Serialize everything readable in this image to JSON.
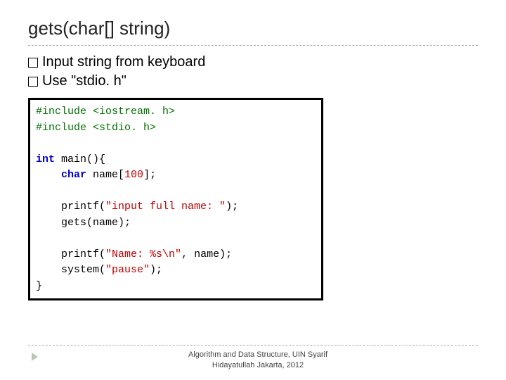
{
  "slide": {
    "title": "gets(char[] string)",
    "bullets": [
      "Input string from keyboard",
      "Use \"stdio. h\""
    ]
  },
  "code": {
    "tokens": [
      {
        "t": "pp",
        "v": "#include <iostream. h>"
      },
      {
        "t": "nl"
      },
      {
        "t": "pp",
        "v": "#include <stdio. h>"
      },
      {
        "t": "nl"
      },
      {
        "t": "nl"
      },
      {
        "t": "kw",
        "v": "int"
      },
      {
        "t": "pl",
        "v": " main(){"
      },
      {
        "t": "nl"
      },
      {
        "t": "pl",
        "v": "    "
      },
      {
        "t": "ty",
        "v": "char"
      },
      {
        "t": "pl",
        "v": " name["
      },
      {
        "t": "num",
        "v": "100"
      },
      {
        "t": "pl",
        "v": "];"
      },
      {
        "t": "nl"
      },
      {
        "t": "nl"
      },
      {
        "t": "pl",
        "v": "    printf("
      },
      {
        "t": "str",
        "v": "\"input full name: \""
      },
      {
        "t": "pl",
        "v": ");"
      },
      {
        "t": "nl"
      },
      {
        "t": "pl",
        "v": "    gets(name);"
      },
      {
        "t": "nl"
      },
      {
        "t": "nl"
      },
      {
        "t": "pl",
        "v": "    printf("
      },
      {
        "t": "str",
        "v": "\"Name: %s\\n\""
      },
      {
        "t": "pl",
        "v": ", name);"
      },
      {
        "t": "nl"
      },
      {
        "t": "pl",
        "v": "    system("
      },
      {
        "t": "str",
        "v": "\"pause\""
      },
      {
        "t": "pl",
        "v": ");"
      },
      {
        "t": "nl"
      },
      {
        "t": "pl",
        "v": "}"
      }
    ]
  },
  "footer": {
    "line1": "Algorithm and Data Structure, UIN Syarif",
    "line2": "Hidayatullah Jakarta, 2012"
  }
}
